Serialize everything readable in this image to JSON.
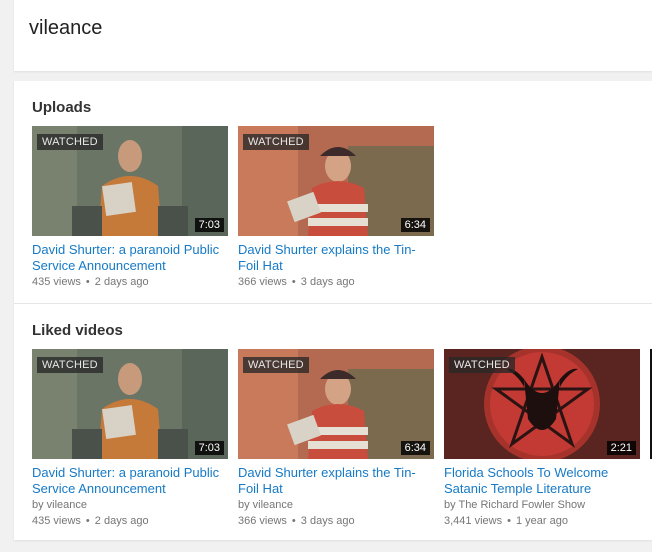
{
  "channel": {
    "name": "vileance"
  },
  "uploads": {
    "title": "Uploads",
    "videos": [
      {
        "title": "David Shurter: a paranoid Public Service Announcement",
        "badge": "WATCHED",
        "duration": "7:03",
        "views": "435 views",
        "age": "2 days ago"
      },
      {
        "title": "David Shurter explains the Tin-Foil Hat",
        "badge": "WATCHED",
        "duration": "6:34",
        "views": "366 views",
        "age": "3 days ago"
      }
    ]
  },
  "liked": {
    "title": "Liked videos",
    "videos": [
      {
        "title": "David Shurter: a paranoid Public Service Announcement",
        "badge": "WATCHED",
        "duration": "7:03",
        "by": "by vileance",
        "views": "435 views",
        "age": "2 days ago"
      },
      {
        "title": "David Shurter explains the Tin-Foil Hat",
        "badge": "WATCHED",
        "duration": "6:34",
        "by": "by vileance",
        "views": "366 views",
        "age": "3 days ago"
      },
      {
        "title": "Florida Schools To Welcome Satanic Temple Literature",
        "badge": "WATCHED",
        "duration": "2:21",
        "by": "by The Richard Fowler Show",
        "views": "3,441 views",
        "age": "1 year ago"
      }
    ]
  },
  "colors": {
    "link": "#167ac6",
    "meta": "#767676",
    "background": "#f1f1f1"
  }
}
